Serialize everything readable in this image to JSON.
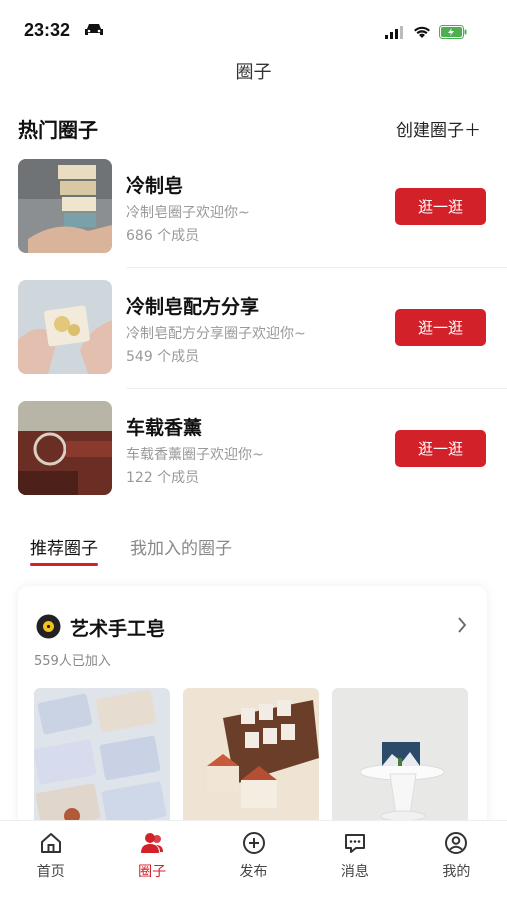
{
  "status_bar": {
    "time": "23:32"
  },
  "nav": {
    "title": "圈子"
  },
  "hot": {
    "title": "热门圈子",
    "create_label": "创建圈子＋",
    "items": [
      {
        "name": "冷制皂",
        "desc": "冷制皂圈子欢迎你~",
        "members": "686 个成员",
        "button": "逛一逛"
      },
      {
        "name": "冷制皂配方分享",
        "desc": "冷制皂配方分享圈子欢迎你~",
        "members": "549 个成员",
        "button": "逛一逛"
      },
      {
        "name": "车载香薰",
        "desc": "车载香薰圈子欢迎你~",
        "members": "122 个成员",
        "button": "逛一逛"
      }
    ]
  },
  "tabs": [
    {
      "label": "推荐圈子",
      "active": true
    },
    {
      "label": "我加入的圈子",
      "active": false
    }
  ],
  "recommend": {
    "title": "艺术手工皂",
    "count": "559人已加入"
  },
  "tabbar": [
    {
      "label": "首页",
      "icon": "home-icon"
    },
    {
      "label": "圈子",
      "icon": "community-icon"
    },
    {
      "label": "发布",
      "icon": "publish-icon"
    },
    {
      "label": "消息",
      "icon": "message-icon"
    },
    {
      "label": "我的",
      "icon": "profile-icon"
    }
  ],
  "colors": {
    "accent": "#d3212a"
  }
}
